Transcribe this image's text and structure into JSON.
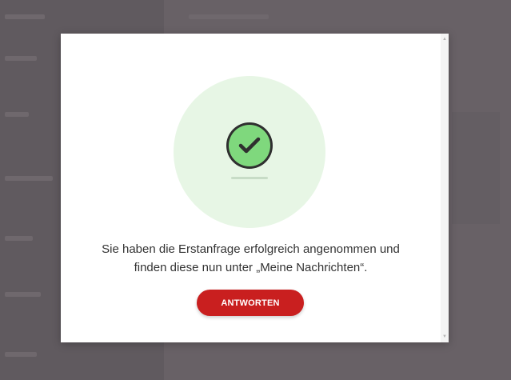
{
  "modal": {
    "message_line1": "Sie haben die Erstanfrage erfolgreich angenommen und",
    "message_line2": "finden diese nun unter „Meine Nachrichten“.",
    "button_label": "ANTWORTEN"
  },
  "colors": {
    "accent": "#c91f1f",
    "success": "#7fd87d",
    "success_bg": "#e7f6e5"
  },
  "icons": {
    "success": "checkmark-icon"
  }
}
